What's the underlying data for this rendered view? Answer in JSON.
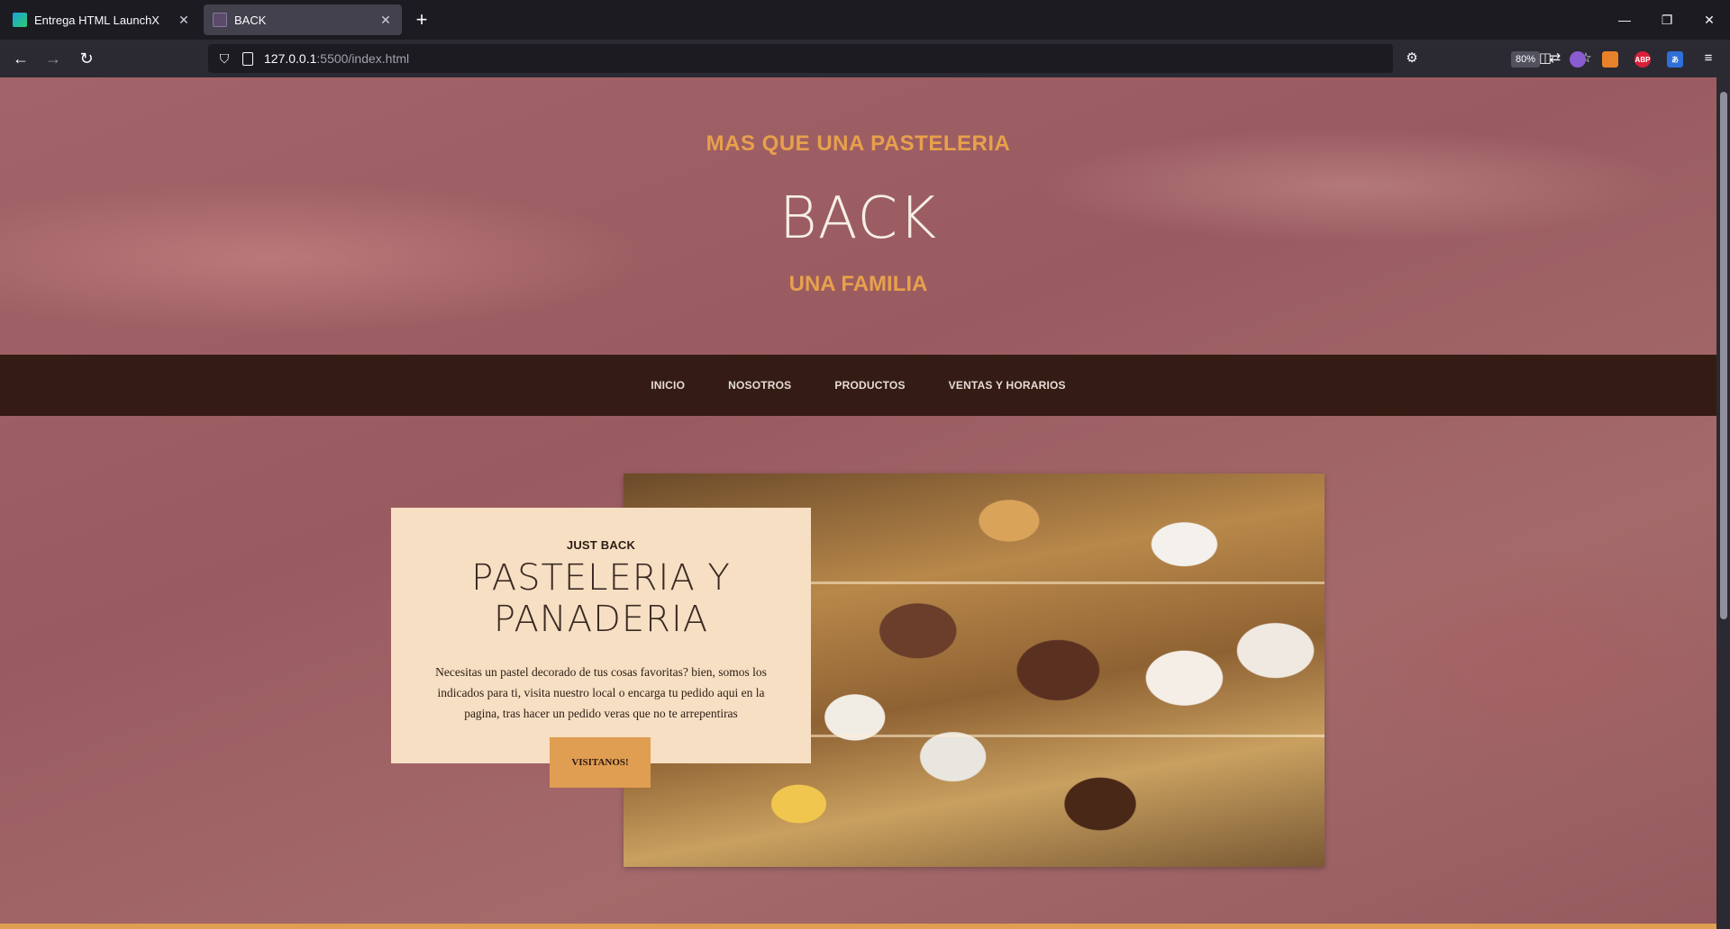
{
  "browser": {
    "tabs": [
      {
        "title": "Entrega HTML LaunchX",
        "active": false,
        "favicon": "launchx-icon"
      },
      {
        "title": "BACK",
        "active": true,
        "favicon": "page-icon"
      }
    ],
    "url_host": "127.0.0.1",
    "url_rest": ":5500/index.html",
    "zoom": "80%",
    "extensions": {
      "abp_label": "ABP",
      "translate_label": "あ"
    }
  },
  "page": {
    "hero": {
      "kicker": "MAS QUE UNA PASTELERIA",
      "title": "BACK",
      "subtitle": "UNA FAMILIA"
    },
    "nav": {
      "items": [
        "INICIO",
        "NOSOTROS",
        "PRODUCTOS",
        "VENTAS Y HORARIOS"
      ]
    },
    "promo": {
      "eyebrow": "JUST BACK",
      "title": "PASTELERIA Y PANADERIA",
      "body": "Necesitas un pastel decorado de tus cosas favoritas? bien, somos los indicados para ti, visita nuestro local o encarga tu pedido aqui en la pagina, tras hacer un pedido veras que no te arrepentiras",
      "button": "VISITANOS!"
    },
    "colors": {
      "accent": "#e09e52",
      "nav_bg": "#341c14",
      "card_bg": "#f6dfc3",
      "page_bg": "#a26468"
    }
  }
}
